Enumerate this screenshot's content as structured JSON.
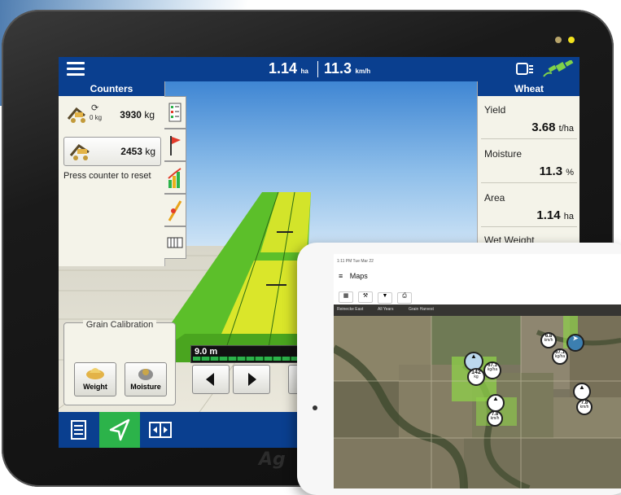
{
  "display": {
    "status": {
      "area_value": "1.14",
      "area_unit": "ha",
      "speed_value": "11.3",
      "speed_unit": "km/h"
    },
    "counters": {
      "title": "Counters",
      "items": [
        {
          "value": "3930",
          "unit": "kg",
          "sub": "0 kg"
        },
        {
          "value": "2453",
          "unit": "kg"
        }
      ],
      "reset_hint": "Press counter to reset"
    },
    "crop_panel": {
      "title": "Wheat",
      "stats": [
        {
          "label": "Yield",
          "value": "3.68",
          "unit": "t/ha"
        },
        {
          "label": "Moisture",
          "value": "11.3",
          "unit": "%"
        },
        {
          "label": "Area",
          "value": "1.14",
          "unit": "ha"
        },
        {
          "label": "Wet Weight"
        }
      ]
    },
    "grain_calibration": {
      "title": "Grain Calibration",
      "weight_label": "Weight",
      "moisture_label": "Moisture"
    },
    "lightbar": {
      "distance": "9.0 m"
    },
    "brand": "Ag",
    "colors": {
      "header_blue": "#0a3f8f",
      "active_green": "#2cb34a",
      "field_green": "#5cbf2a",
      "field_yellow": "#e8ea2a"
    },
    "icons": [
      "menu-icon",
      "camera-icon",
      "gps-satellite-icon",
      "document-icon",
      "navigation-icon",
      "split-view-icon"
    ]
  },
  "ipad": {
    "status_time": "1:11 PM  Tue Mar 22",
    "title": "Maps",
    "filters": [
      "Reinecke East",
      "All Years",
      "Grain Harvest"
    ],
    "map_markers": [
      {
        "value": "6.8",
        "unit": "km/h"
      },
      {
        "value": "67.1",
        "unit": "kg/ha"
      },
      {
        "value": "142",
        "unit": "kg"
      },
      {
        "value": "67.1",
        "unit": "kg/ha"
      },
      {
        "value": "7.8",
        "unit": "km/h"
      },
      {
        "value": "7.8",
        "unit": "km/h"
      }
    ]
  }
}
